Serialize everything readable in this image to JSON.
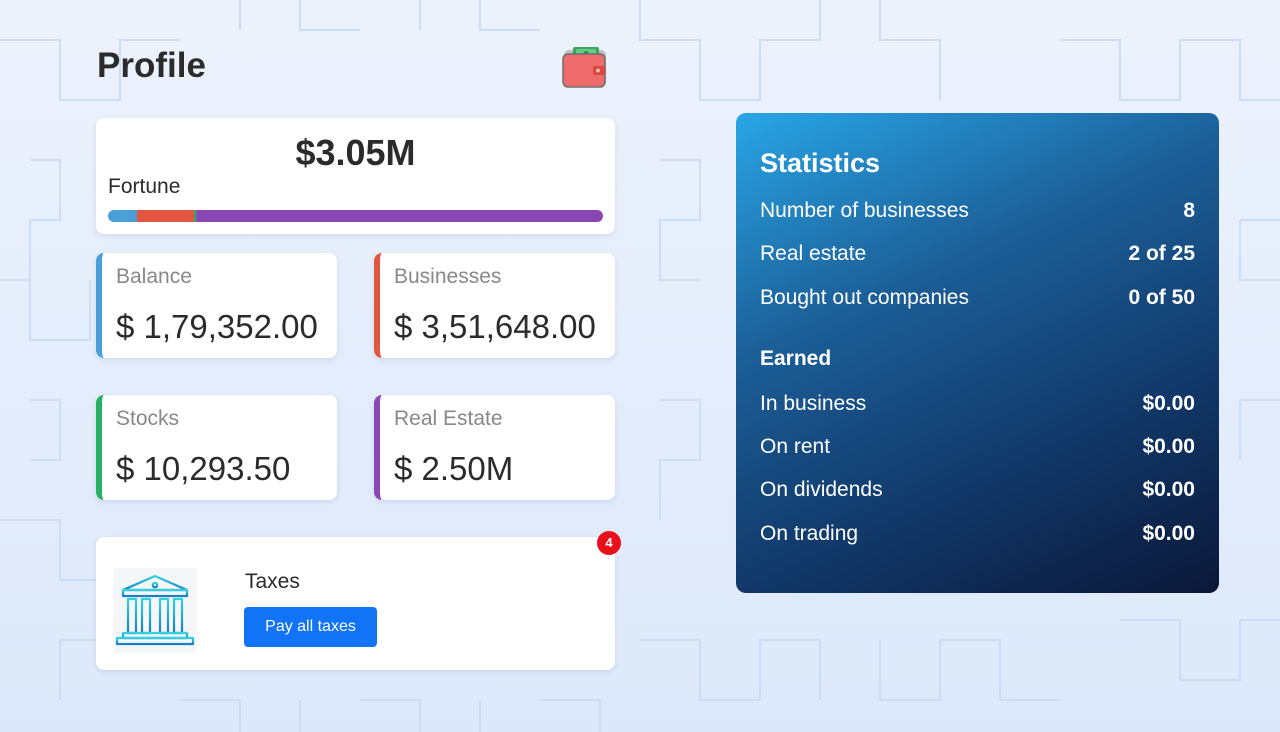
{
  "header": {
    "title": "Profile",
    "wallet_icon": "wallet-icon"
  },
  "fortune": {
    "value": "$3.05M",
    "label": "Fortune",
    "segments": [
      {
        "name": "balance",
        "fraction": 0.059,
        "color": "#4a9fd8"
      },
      {
        "name": "businesses",
        "fraction": 0.115,
        "color": "#e25540"
      },
      {
        "name": "stocks",
        "fraction": 0.003,
        "color": "#28b063"
      },
      {
        "name": "real-estate",
        "fraction": 0.823,
        "color": "#8a46b3"
      }
    ]
  },
  "cards": {
    "balance": {
      "label": "Balance",
      "value": "$ 1,79,352.00",
      "color": "#4a9fd8"
    },
    "businesses": {
      "label": "Businesses",
      "value": "$ 3,51,648.00",
      "color": "#e25540"
    },
    "stocks": {
      "label": "Stocks",
      "value": "$ 10,293.50",
      "color": "#28b063"
    },
    "real_estate": {
      "label": "Real Estate",
      "value": "$ 2.50M",
      "color": "#8a46b3"
    }
  },
  "taxes": {
    "title": "Taxes",
    "button_label": "Pay all taxes",
    "badge_count": "4",
    "icon": "bank-building-icon"
  },
  "statistics": {
    "title": "Statistics",
    "rows": [
      {
        "label": "Number of businesses",
        "value": "8"
      },
      {
        "label": "Real estate",
        "value": "2 of 25"
      },
      {
        "label": "Bought out companies",
        "value": "0 of 50"
      }
    ],
    "earned_heading": "Earned",
    "earned_rows": [
      {
        "label": "In business",
        "value": "$0.00"
      },
      {
        "label": "On rent",
        "value": "$0.00"
      },
      {
        "label": "On dividends",
        "value": "$0.00"
      },
      {
        "label": "On trading",
        "value": "$0.00"
      }
    ]
  },
  "colors": {
    "accent_button": "#1173f5",
    "badge": "#e8101a",
    "panel_gradient_start": "#29a6e6",
    "panel_gradient_end": "#0b1738"
  }
}
